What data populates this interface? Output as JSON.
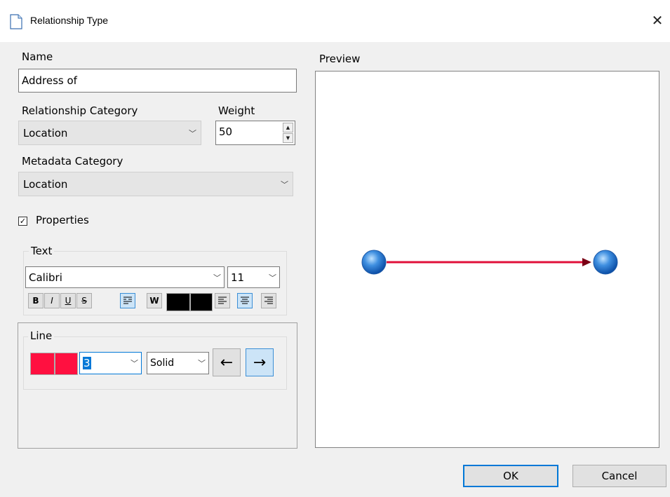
{
  "window": {
    "title": "Relationship Type"
  },
  "name": {
    "label": "Name",
    "value": "Address of"
  },
  "relationship_category": {
    "label": "Relationship Category",
    "value": "Location"
  },
  "weight": {
    "label": "Weight",
    "value": "50"
  },
  "metadata_category": {
    "label": "Metadata Category",
    "value": "Location"
  },
  "properties": {
    "label": "Properties",
    "checked": true
  },
  "text_group": {
    "title": "Text",
    "font": "Calibri",
    "size": "11",
    "buttons": {
      "bold": "B",
      "italic": "I",
      "underline": "U",
      "strike": "S",
      "wrap": "W"
    }
  },
  "line_group": {
    "title": "Line",
    "width": "3",
    "style": "Solid",
    "color": "#ff1040"
  },
  "preview": {
    "label": "Preview",
    "line_color": "#e0103a",
    "node_color": "#3f8fe0"
  },
  "buttons": {
    "ok": "OK",
    "cancel": "Cancel"
  }
}
